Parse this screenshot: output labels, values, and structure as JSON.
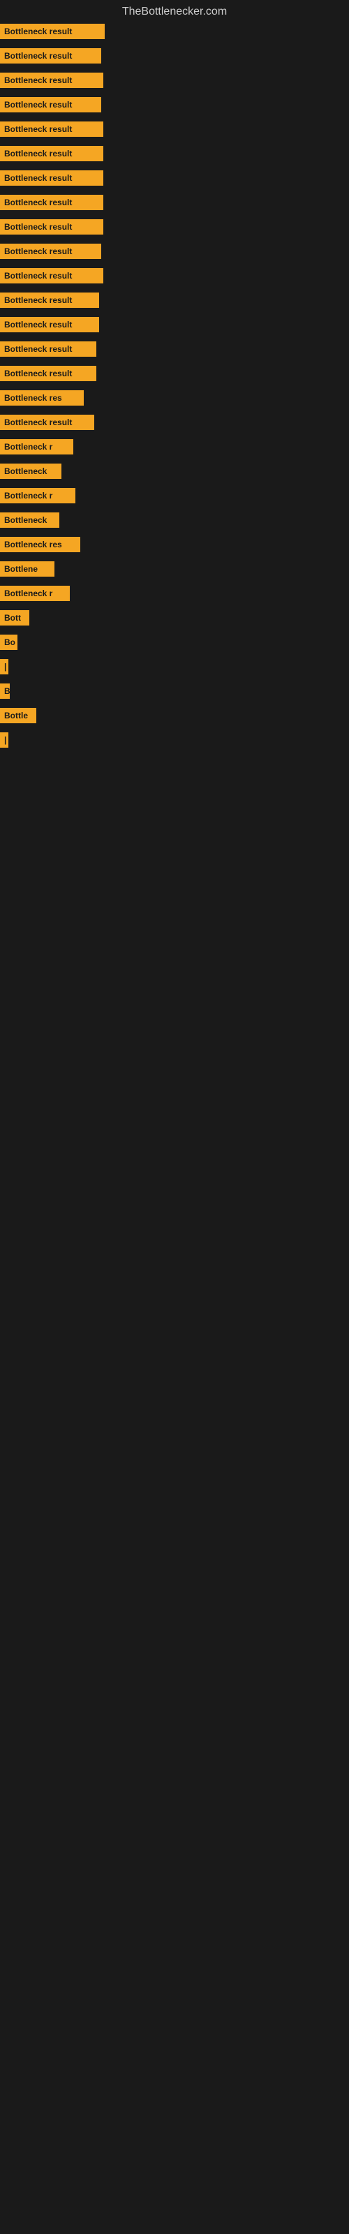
{
  "site": {
    "title": "TheBottlenecker.com"
  },
  "rows": [
    {
      "label": "Bottleneck result",
      "width": 150
    },
    {
      "label": "Bottleneck result",
      "width": 145
    },
    {
      "label": "Bottleneck result",
      "width": 148
    },
    {
      "label": "Bottleneck result",
      "width": 145
    },
    {
      "label": "Bottleneck result",
      "width": 148
    },
    {
      "label": "Bottleneck result",
      "width": 148
    },
    {
      "label": "Bottleneck result",
      "width": 148
    },
    {
      "label": "Bottleneck result",
      "width": 148
    },
    {
      "label": "Bottleneck result",
      "width": 148
    },
    {
      "label": "Bottleneck result",
      "width": 145
    },
    {
      "label": "Bottleneck result",
      "width": 148
    },
    {
      "label": "Bottleneck result",
      "width": 142
    },
    {
      "label": "Bottleneck result",
      "width": 142
    },
    {
      "label": "Bottleneck result",
      "width": 138
    },
    {
      "label": "Bottleneck result",
      "width": 138
    },
    {
      "label": "Bottleneck res",
      "width": 120
    },
    {
      "label": "Bottleneck result",
      "width": 135
    },
    {
      "label": "Bottleneck r",
      "width": 105
    },
    {
      "label": "Bottleneck",
      "width": 88
    },
    {
      "label": "Bottleneck r",
      "width": 108
    },
    {
      "label": "Bottleneck",
      "width": 85
    },
    {
      "label": "Bottleneck res",
      "width": 115
    },
    {
      "label": "Bottlene",
      "width": 78
    },
    {
      "label": "Bottleneck r",
      "width": 100
    },
    {
      "label": "Bott",
      "width": 42
    },
    {
      "label": "Bo",
      "width": 25
    },
    {
      "label": "|",
      "width": 8
    },
    {
      "label": "B",
      "width": 14
    },
    {
      "label": "Bottle",
      "width": 52
    },
    {
      "label": "|",
      "width": 6
    }
  ]
}
